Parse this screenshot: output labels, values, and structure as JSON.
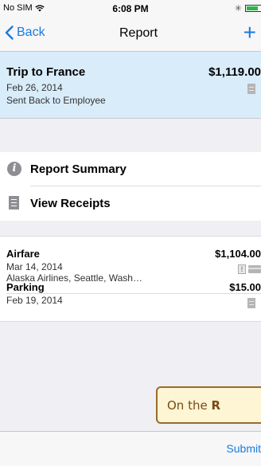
{
  "status_bar": {
    "carrier": "No SIM",
    "time": "6:08 PM"
  },
  "nav": {
    "back_label": "Back",
    "title": "Report",
    "add_label": "+"
  },
  "report": {
    "title": "Trip to France",
    "amount": "$1,119.00",
    "date": "Feb 26, 2014",
    "status": "Sent Back to Employee"
  },
  "actions": [
    {
      "label": "Report Summary",
      "icon": "info-icon"
    },
    {
      "label": "View Receipts",
      "icon": "receipt-icon"
    }
  ],
  "expenses": [
    {
      "name": "Airfare",
      "amount": "$1,104.00",
      "date": "Mar 14, 2014",
      "detail": "Alaska Airlines, Seattle, Wash…",
      "icons": [
        "warning-icon",
        "credit-card-icon"
      ]
    },
    {
      "name": "Parking",
      "amount": "$15.00",
      "date": "Feb 19, 2014",
      "icons": [
        "receipt-icon"
      ]
    }
  ],
  "callout": {
    "prefix": "On the ",
    "bold": "R"
  },
  "toolbar": {
    "submit_label": "Submit"
  },
  "colors": {
    "accent": "#1a7ae0",
    "header_bg": "#d9ecfa",
    "callout_bg": "#fdf5d3",
    "callout_border": "#9a6b2a"
  }
}
